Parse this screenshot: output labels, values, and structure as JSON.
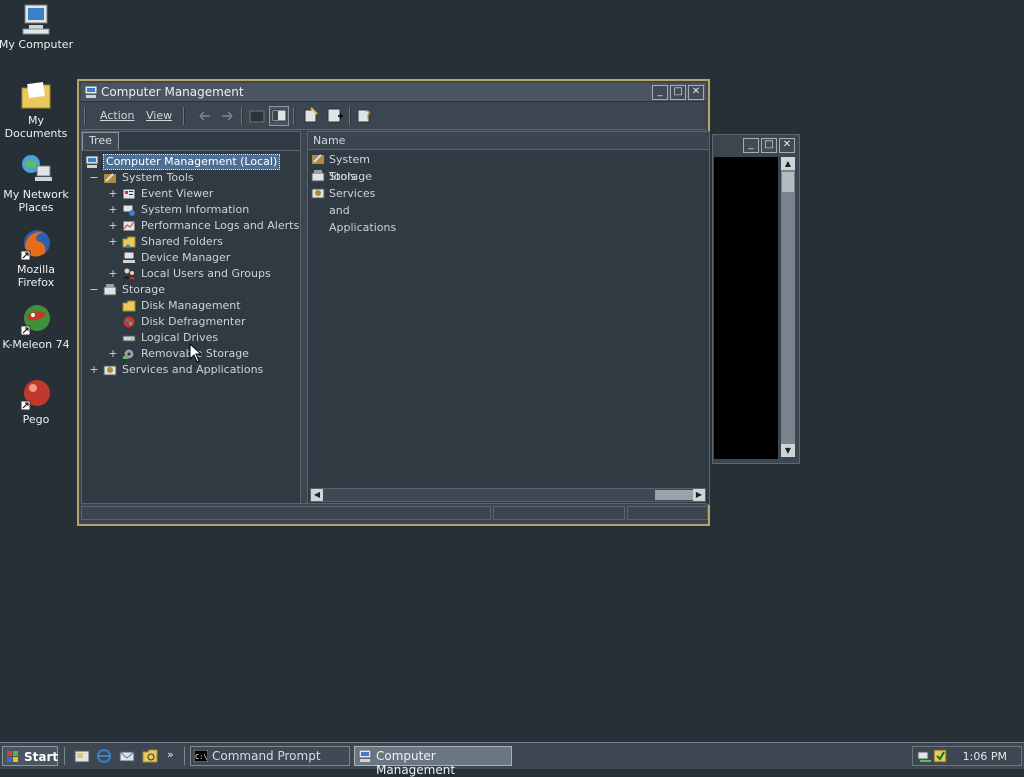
{
  "desktop": {
    "icons": [
      {
        "label": "My Computer"
      },
      {
        "label": "My Documents"
      },
      {
        "label": "My Network Places"
      },
      {
        "label": "Mozilla Firefox"
      },
      {
        "label": "K-Meleon 74"
      },
      {
        "label": "Pego"
      }
    ]
  },
  "main_window": {
    "title": "Computer Management",
    "menu": {
      "action": "Action",
      "view": "View"
    },
    "tree_tab": "Tree",
    "tree": [
      {
        "label": "Computer Management (Local)",
        "expander": ""
      },
      {
        "label": "System Tools",
        "expander": "−"
      },
      {
        "label": "Event Viewer",
        "expander": "+"
      },
      {
        "label": "System Information",
        "expander": "+"
      },
      {
        "label": "Performance Logs and Alerts",
        "expander": "+"
      },
      {
        "label": "Shared Folders",
        "expander": "+"
      },
      {
        "label": "Device Manager",
        "expander": ""
      },
      {
        "label": "Local Users and Groups",
        "expander": "+"
      },
      {
        "label": "Storage",
        "expander": "−"
      },
      {
        "label": "Disk Management",
        "expander": ""
      },
      {
        "label": "Disk Defragmenter",
        "expander": ""
      },
      {
        "label": "Logical Drives",
        "expander": ""
      },
      {
        "label": "Removable Storage",
        "expander": "+"
      },
      {
        "label": "Services and Applications",
        "expander": "+"
      }
    ],
    "list_header": "Name",
    "list_items": [
      {
        "label": "System Tools"
      },
      {
        "label": "Storage"
      },
      {
        "label": "Services and Applications"
      }
    ]
  },
  "taskbar": {
    "start_label": "Start",
    "quicklaunch_more": "»",
    "tasks": [
      {
        "label": "Command Prompt",
        "active": false
      },
      {
        "label": "Computer Management",
        "active": true
      }
    ],
    "clock": "1:06 PM"
  },
  "colors": {
    "desktop": "#263036",
    "window_border": "#b4a66b",
    "selection": "#4d6f93"
  }
}
